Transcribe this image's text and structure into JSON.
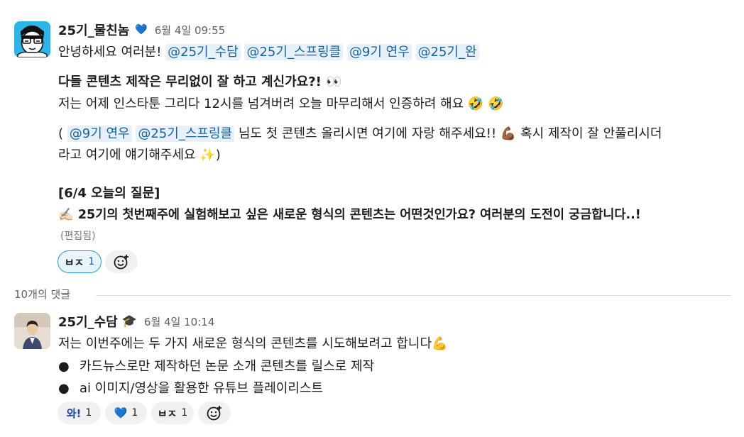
{
  "thread": {
    "msg1": {
      "author": "25기_물친놈",
      "badge": "💙",
      "timestamp": "6월 4일 09:55",
      "greeting": "안녕하세요 여러분!",
      "mentions": [
        "@25기_수담",
        "@25기_스프링클",
        "@9기 연우",
        "@25기_완"
      ],
      "line2_bold": "다들 콘텐츠 제작은 무리없이 잘 하고 계신가요?! 👀",
      "line3": "저는 어제 인스타툰 그리다 12시를 넘겨버려 오늘 마무리해서 인증하려 해요 🤣 🤣",
      "line4_open": "(",
      "line4_mentions": [
        "@9기 연우",
        "@25기_스프링클"
      ],
      "line4_rest": "님도 첫 콘텐츠 올리시면 여기에 자랑 해주세요!! 💪🏾 혹시 제작이 잘 안풀리시더",
      "line5": "라고 여기에 얘기해주세요 ✨)",
      "question_title": "[6/4 오늘의 질문]",
      "question": "✍🏻 25기의 첫번째주에 실험해보고 싶은 새로운 형식의 콘텐츠는 어떤것인가요? 여러분의 도전이 궁금합니다..!",
      "edited": "(편집됨)",
      "reactions": [
        {
          "label": "ㅂㅈ",
          "count": "1",
          "active": true
        }
      ]
    },
    "replies_label": "10개의 댓글",
    "msg2": {
      "author": "25기_수담",
      "badge": "🎓",
      "timestamp": "6월 4일 10:14",
      "text": "저는 이번주에는 두 가지 새로운 형식의 콘텐츠를 시도해보려고 합니다💪",
      "bullets": [
        "카드뉴스로만 제작하던 논문 소개 콘텐츠를 릴스로 제작",
        "ai 이미지/영상을 활용한 유튜브 플레이리스트"
      ],
      "reactions": [
        {
          "label": "와!",
          "count": "1"
        },
        {
          "label": "💙",
          "count": "1"
        },
        {
          "label": "ㅂㅈ",
          "count": "1"
        }
      ]
    }
  },
  "colors": {
    "mention_bg": "#e8f1fa",
    "mention_text": "#1264a3",
    "active_reaction_border": "#1d9bd1",
    "avatar1_bg": "#2bb6ea"
  }
}
